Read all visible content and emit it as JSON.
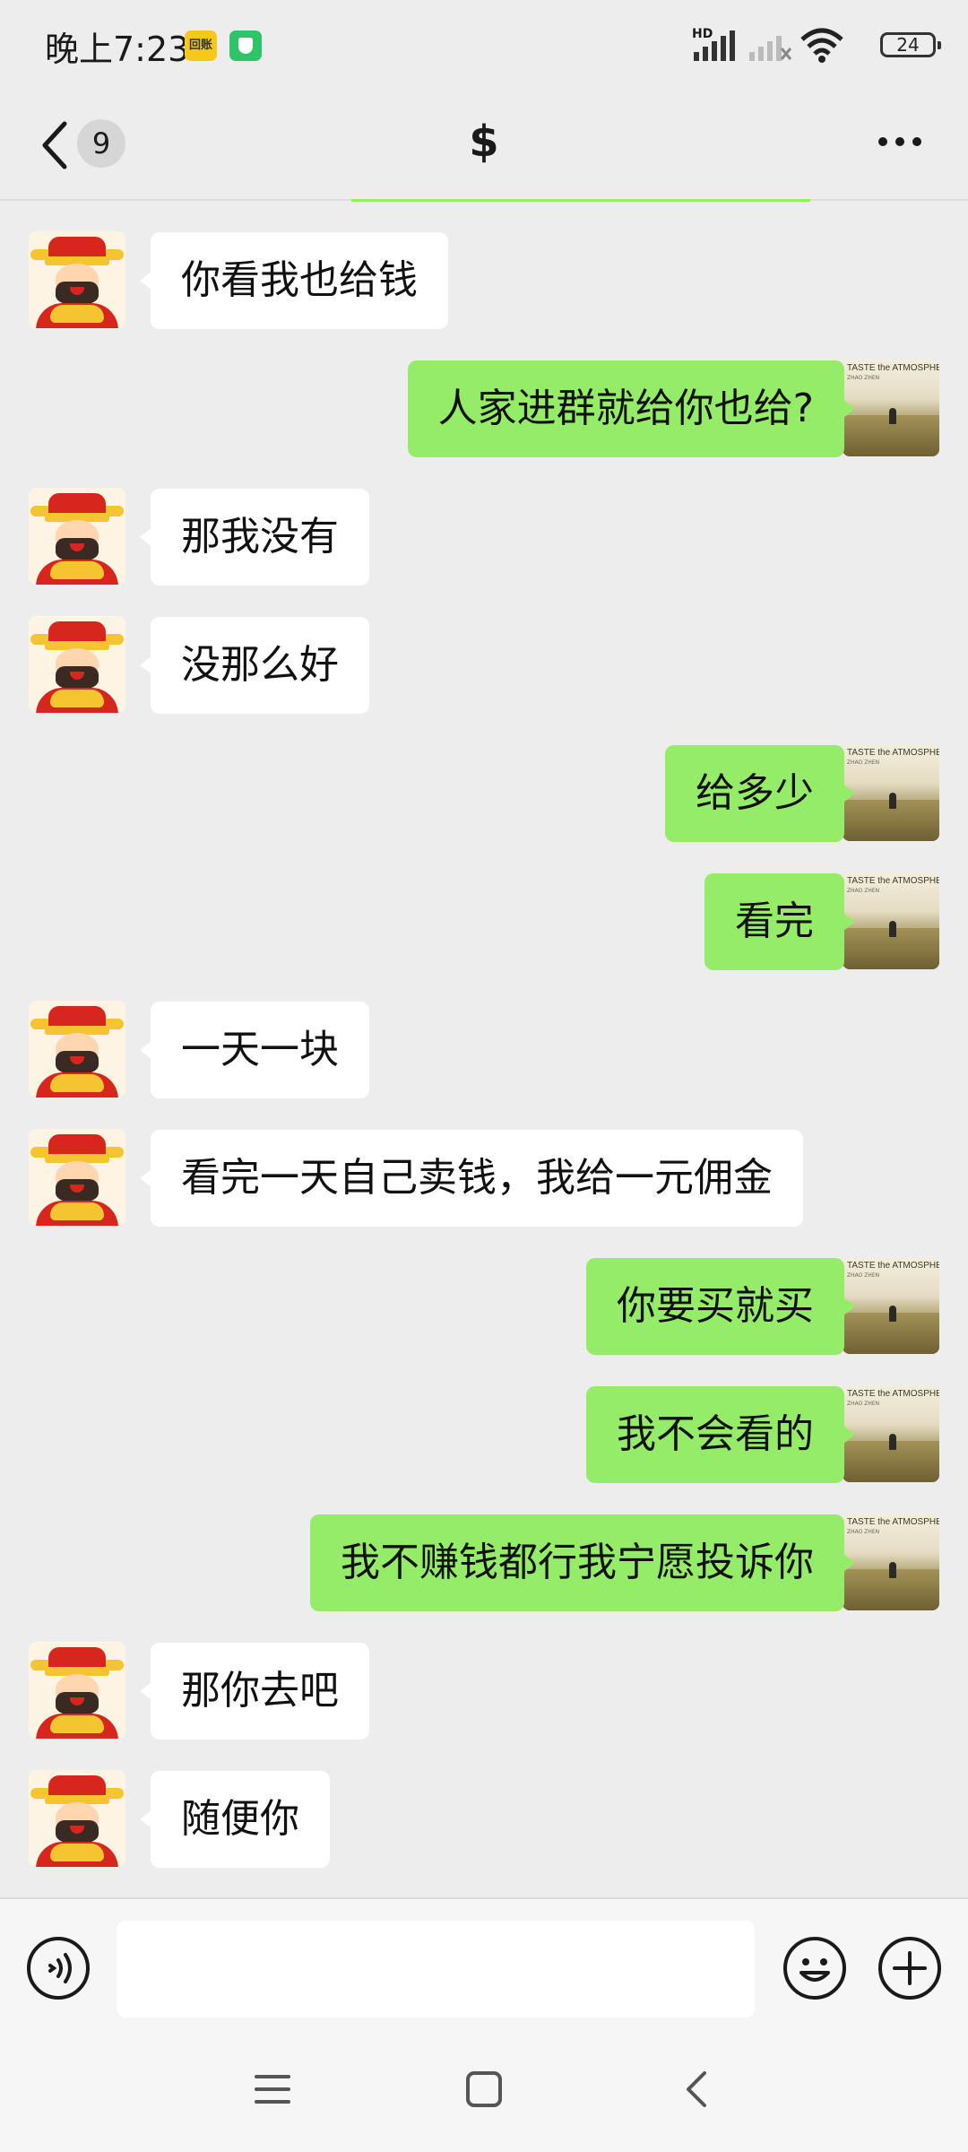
{
  "status_bar": {
    "time": "晚上7:23",
    "app_badge": "回账",
    "network": "HD",
    "battery": "24"
  },
  "header": {
    "unread_count": "9",
    "title": "$",
    "accent_color": "#95ec69"
  },
  "messages": [
    {
      "side": "left",
      "text": "你看我也给钱"
    },
    {
      "side": "right",
      "text": "人家进群就给你也给?"
    },
    {
      "side": "left",
      "text": "那我没有"
    },
    {
      "side": "left",
      "text": "没那么好"
    },
    {
      "side": "right",
      "text": "给多少"
    },
    {
      "side": "right",
      "text": "看完"
    },
    {
      "side": "left",
      "text": "一天一块"
    },
    {
      "side": "left",
      "text": "看完一天自己卖钱，我给一元佣金"
    },
    {
      "side": "right",
      "text": "你要买就买"
    },
    {
      "side": "right",
      "text": "我不会看的"
    },
    {
      "side": "right",
      "text": "我不赚钱都行我宁愿投诉你"
    },
    {
      "side": "left",
      "text": "那你去吧"
    },
    {
      "side": "left",
      "text": "随便你"
    }
  ],
  "self_avatar": {
    "caption": "TASTE the ATMOSPHERE",
    "subcaption": "ZHAO ZHEN"
  },
  "input_bar": {
    "placeholder": ""
  },
  "colors": {
    "sent_bubble": "#95ec69",
    "received_bubble": "#ffffff",
    "background": "#ededed"
  }
}
